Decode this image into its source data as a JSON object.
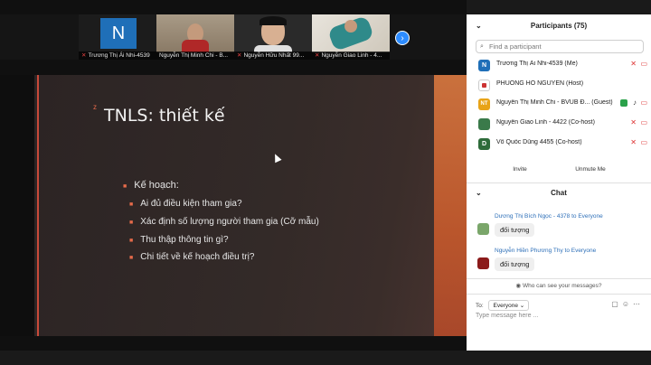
{
  "video_strip": {
    "tiles": [
      {
        "initial": "N",
        "name": "Trương Thị Ái Nhi-4539",
        "muted": true
      },
      {
        "name": "Nguyễn Thị Minh Chi - B...",
        "muted": false
      },
      {
        "name": "Nguyễn Hữu Nhất 99...",
        "muted": true
      },
      {
        "name": "Nguyễn Giao Linh - 4...",
        "muted": true
      }
    ],
    "next_icon": "›"
  },
  "slide": {
    "title": "TNLS: thiết kế",
    "marker": "z",
    "heading": "Kế hoạch:",
    "bullet_glyph": "■",
    "items": [
      "Ai đủ điều kiện tham gia?",
      "Xác định số lượng người tham gia (Cỡ mẫu)",
      "Thu thập thông tin gì?",
      "Chi tiết về kế hoạch điều trị?"
    ]
  },
  "participants": {
    "header": "Participants (75)",
    "search_placeholder": "Find a participant",
    "list": [
      {
        "initial": "N",
        "color": "#1f6fb8",
        "name": "Trương Thị Ái Nhi-4539 (Me)"
      },
      {
        "initial": "",
        "color": "#ffffff",
        "name": "PHUONG HO NGUYEN (Host)"
      },
      {
        "initial": "NT",
        "color": "#e8a317",
        "name": "Nguyễn Thị Minh Chi - BVUB Đ... (Guest)"
      },
      {
        "initial": "",
        "color": "#3a7a4a",
        "name": "Nguyễn Giao Linh - 4422 (Co-host)"
      },
      {
        "initial": "D",
        "color": "#2e6b3a",
        "name": "Võ Quốc Dũng 4455 (Co-host)"
      }
    ],
    "invite_label": "Invite",
    "unmute_label": "Unmute Me"
  },
  "chat": {
    "header": "Chat",
    "messages": [
      {
        "from": "Dương Thị Bích Ngọc - 4378 to Everyone",
        "text": "đối tượng",
        "avatar_color": "#7aa66a"
      },
      {
        "from": "Nguyễn Hiền Phương Thy to Everyone",
        "text": "đối tượng",
        "avatar_color": "#8b1a1a"
      }
    ],
    "who_sees": "Who can see your messages?",
    "to_label": "To:",
    "to_value": "Everyone",
    "input_placeholder": "Type message here ..."
  }
}
